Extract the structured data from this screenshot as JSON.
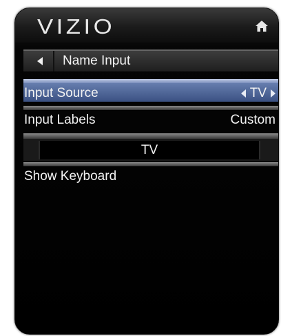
{
  "header": {
    "logo": "VIZIO",
    "home_icon": "home-icon"
  },
  "nav": {
    "back_icon": "back-arrow-icon",
    "title": "Name Input"
  },
  "menu": {
    "input_source": {
      "label": "Input Source",
      "value": "TV",
      "selected": true
    },
    "input_labels": {
      "label": "Input Labels",
      "value": "Custom"
    },
    "name_field": {
      "value": "TV"
    },
    "show_keyboard": {
      "label": "Show Keyboard"
    }
  },
  "colors": {
    "selected_row": "#4d64a0",
    "background": "#000000"
  }
}
